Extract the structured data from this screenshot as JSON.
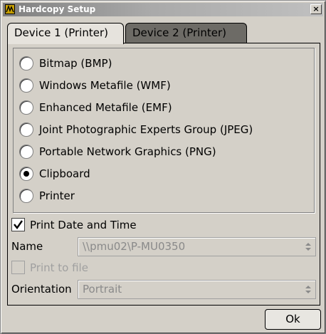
{
  "window": {
    "title": "Hardcopy Setup",
    "close_glyph": "×"
  },
  "tabs": [
    {
      "label": "Device 1 (Printer)",
      "active": true
    },
    {
      "label": "Device 2 (Printer)",
      "active": false
    }
  ],
  "formats": [
    {
      "label": "Bitmap (BMP)",
      "selected": false
    },
    {
      "label": "Windows Metafile (WMF)",
      "selected": false
    },
    {
      "label": "Enhanced Metafile (EMF)",
      "selected": false
    },
    {
      "label": "Joint Photographic Experts Group (JPEG)",
      "selected": false
    },
    {
      "label": "Portable Network Graphics (PNG)",
      "selected": false
    },
    {
      "label": "Clipboard",
      "selected": true
    },
    {
      "label": "Printer",
      "selected": false
    }
  ],
  "print_date_time": {
    "label": "Print Date and Time",
    "checked": true
  },
  "name": {
    "label": "Name",
    "value": "\\\\pmu02\\P-MU0350",
    "enabled": false
  },
  "print_to_file": {
    "label": "Print to file",
    "checked": false,
    "enabled": false
  },
  "orientation": {
    "label": "Orientation",
    "value": "Portrait",
    "enabled": false
  },
  "ok_button": {
    "label": "Ok"
  },
  "icons": {
    "app": "app-logo-icon",
    "close": "close-icon",
    "check": "checkmark-icon",
    "dropdown": "updown-arrow-icon"
  }
}
